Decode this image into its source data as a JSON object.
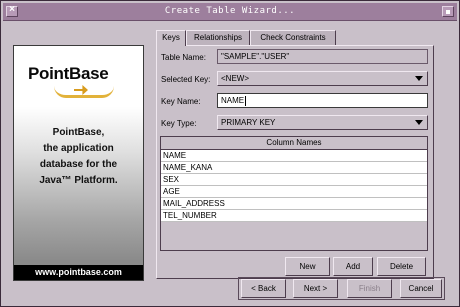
{
  "window": {
    "title": "Create Table Wizard..."
  },
  "banner": {
    "logo": "PointBase",
    "tagline": [
      "PointBase,",
      "the application",
      "database for the",
      "Java™ Platform."
    ],
    "url": "www.pointbase.com"
  },
  "tabs": [
    {
      "label": "Keys",
      "active": true
    },
    {
      "label": "Relationships",
      "active": false
    },
    {
      "label": "Check Constraints",
      "active": false
    }
  ],
  "form": {
    "table_name_label": "Table Name:",
    "table_name_value": "\"SAMPLE\".\"USER\"",
    "selected_key_label": "Selected Key:",
    "selected_key_value": "<NEW>",
    "key_name_label": "Key Name:",
    "key_name_value": "NAME",
    "key_type_label": "Key Type:",
    "key_type_value": "PRIMARY KEY"
  },
  "columns": {
    "header": "Column Names",
    "rows": [
      "NAME",
      "NAME_KANA",
      "SEX",
      "AGE",
      "MAIL_ADDRESS",
      "TEL_NUMBER"
    ]
  },
  "key_buttons": {
    "new": "New",
    "add": "Add",
    "delete": "Delete"
  },
  "nav_buttons": {
    "back": "< Back",
    "next": "Next >",
    "finish": "Finish",
    "cancel": "Cancel"
  },
  "icons": [
    "close-icon",
    "minimize-icon"
  ]
}
